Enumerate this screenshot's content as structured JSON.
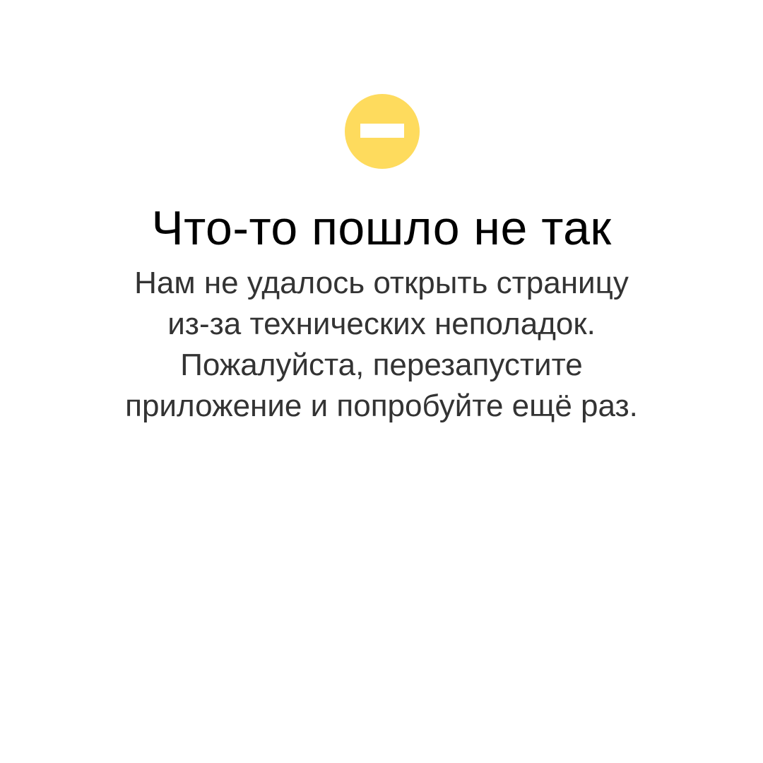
{
  "error": {
    "icon": "stop-icon",
    "icon_color": "#FEDB5D",
    "title": "Что-то пошло не так",
    "message_lines": [
      "Нам не удалось открыть страницу",
      "из-за технических неполадок.",
      "Пожалуйста, перезапустите",
      "приложение и попробуйте ещё раз."
    ]
  }
}
